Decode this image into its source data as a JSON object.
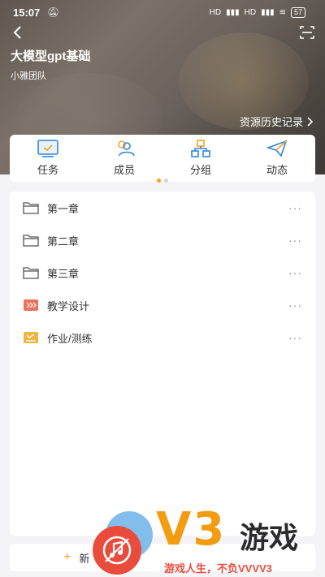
{
  "status": {
    "time": "15:07",
    "battery": "57",
    "signal1": "HD",
    "signal2": "HD"
  },
  "header": {
    "course_title": "大模型gpt基础",
    "team": "小雅团队",
    "history_link": "资源历史记录"
  },
  "quick_nav": [
    {
      "label": "任务",
      "icon": "task-icon"
    },
    {
      "label": "成员",
      "icon": "members-icon"
    },
    {
      "label": "分组",
      "icon": "group-icon"
    },
    {
      "label": "动态",
      "icon": "activity-icon"
    }
  ],
  "resources": [
    {
      "name": "第一章",
      "icon": "folder-icon"
    },
    {
      "name": "第二章",
      "icon": "folder-icon"
    },
    {
      "name": "第三章",
      "icon": "folder-icon"
    },
    {
      "name": "教学设计",
      "icon": "teaching-design-icon"
    },
    {
      "name": "作业/测练",
      "icon": "homework-icon"
    }
  ],
  "more_label": "···",
  "new_button": {
    "label": "新",
    "plus": "+"
  },
  "watermark": {
    "logo": "V3",
    "name": "游戏",
    "slogan": "游戏人生，不负VVVV3"
  },
  "colors": {
    "accent": "#f5a623",
    "icon_blue": "#2f86d6",
    "teaching_red": "#e8735e",
    "homework_yellow": "#f0b445"
  }
}
